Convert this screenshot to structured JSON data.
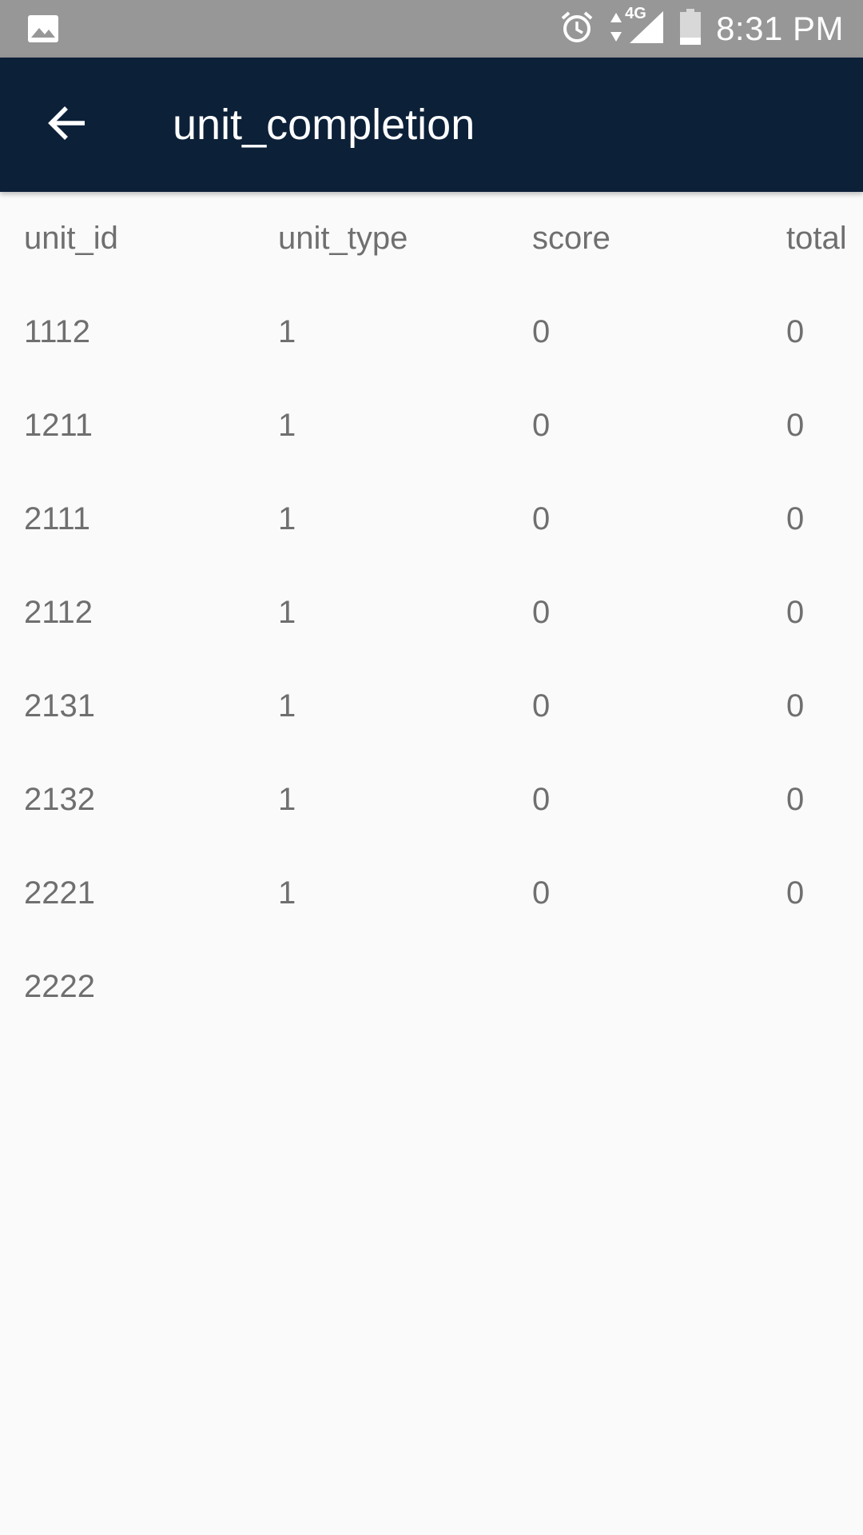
{
  "status_bar": {
    "time": "8:31 PM",
    "network": "4G",
    "icons": [
      "image-icon",
      "alarm-icon",
      "data-arrows-icon",
      "signal-icon",
      "battery-icon"
    ]
  },
  "app_bar": {
    "title": "unit_completion",
    "back_icon": "arrow-back-icon",
    "background": "#0c2038"
  },
  "table": {
    "headers": [
      "unit_id",
      "unit_type",
      "score",
      "total"
    ],
    "rows": [
      [
        "1112",
        "1",
        "0",
        "0"
      ],
      [
        "1211",
        "1",
        "0",
        "0"
      ],
      [
        "2111",
        "1",
        "0",
        "0"
      ],
      [
        "2112",
        "1",
        "0",
        "0"
      ],
      [
        "2131",
        "1",
        "0",
        "0"
      ],
      [
        "2132",
        "1",
        "0",
        "0"
      ],
      [
        "2221",
        "1",
        "0",
        "0"
      ],
      [
        "2222",
        "",
        "",
        ""
      ]
    ]
  }
}
